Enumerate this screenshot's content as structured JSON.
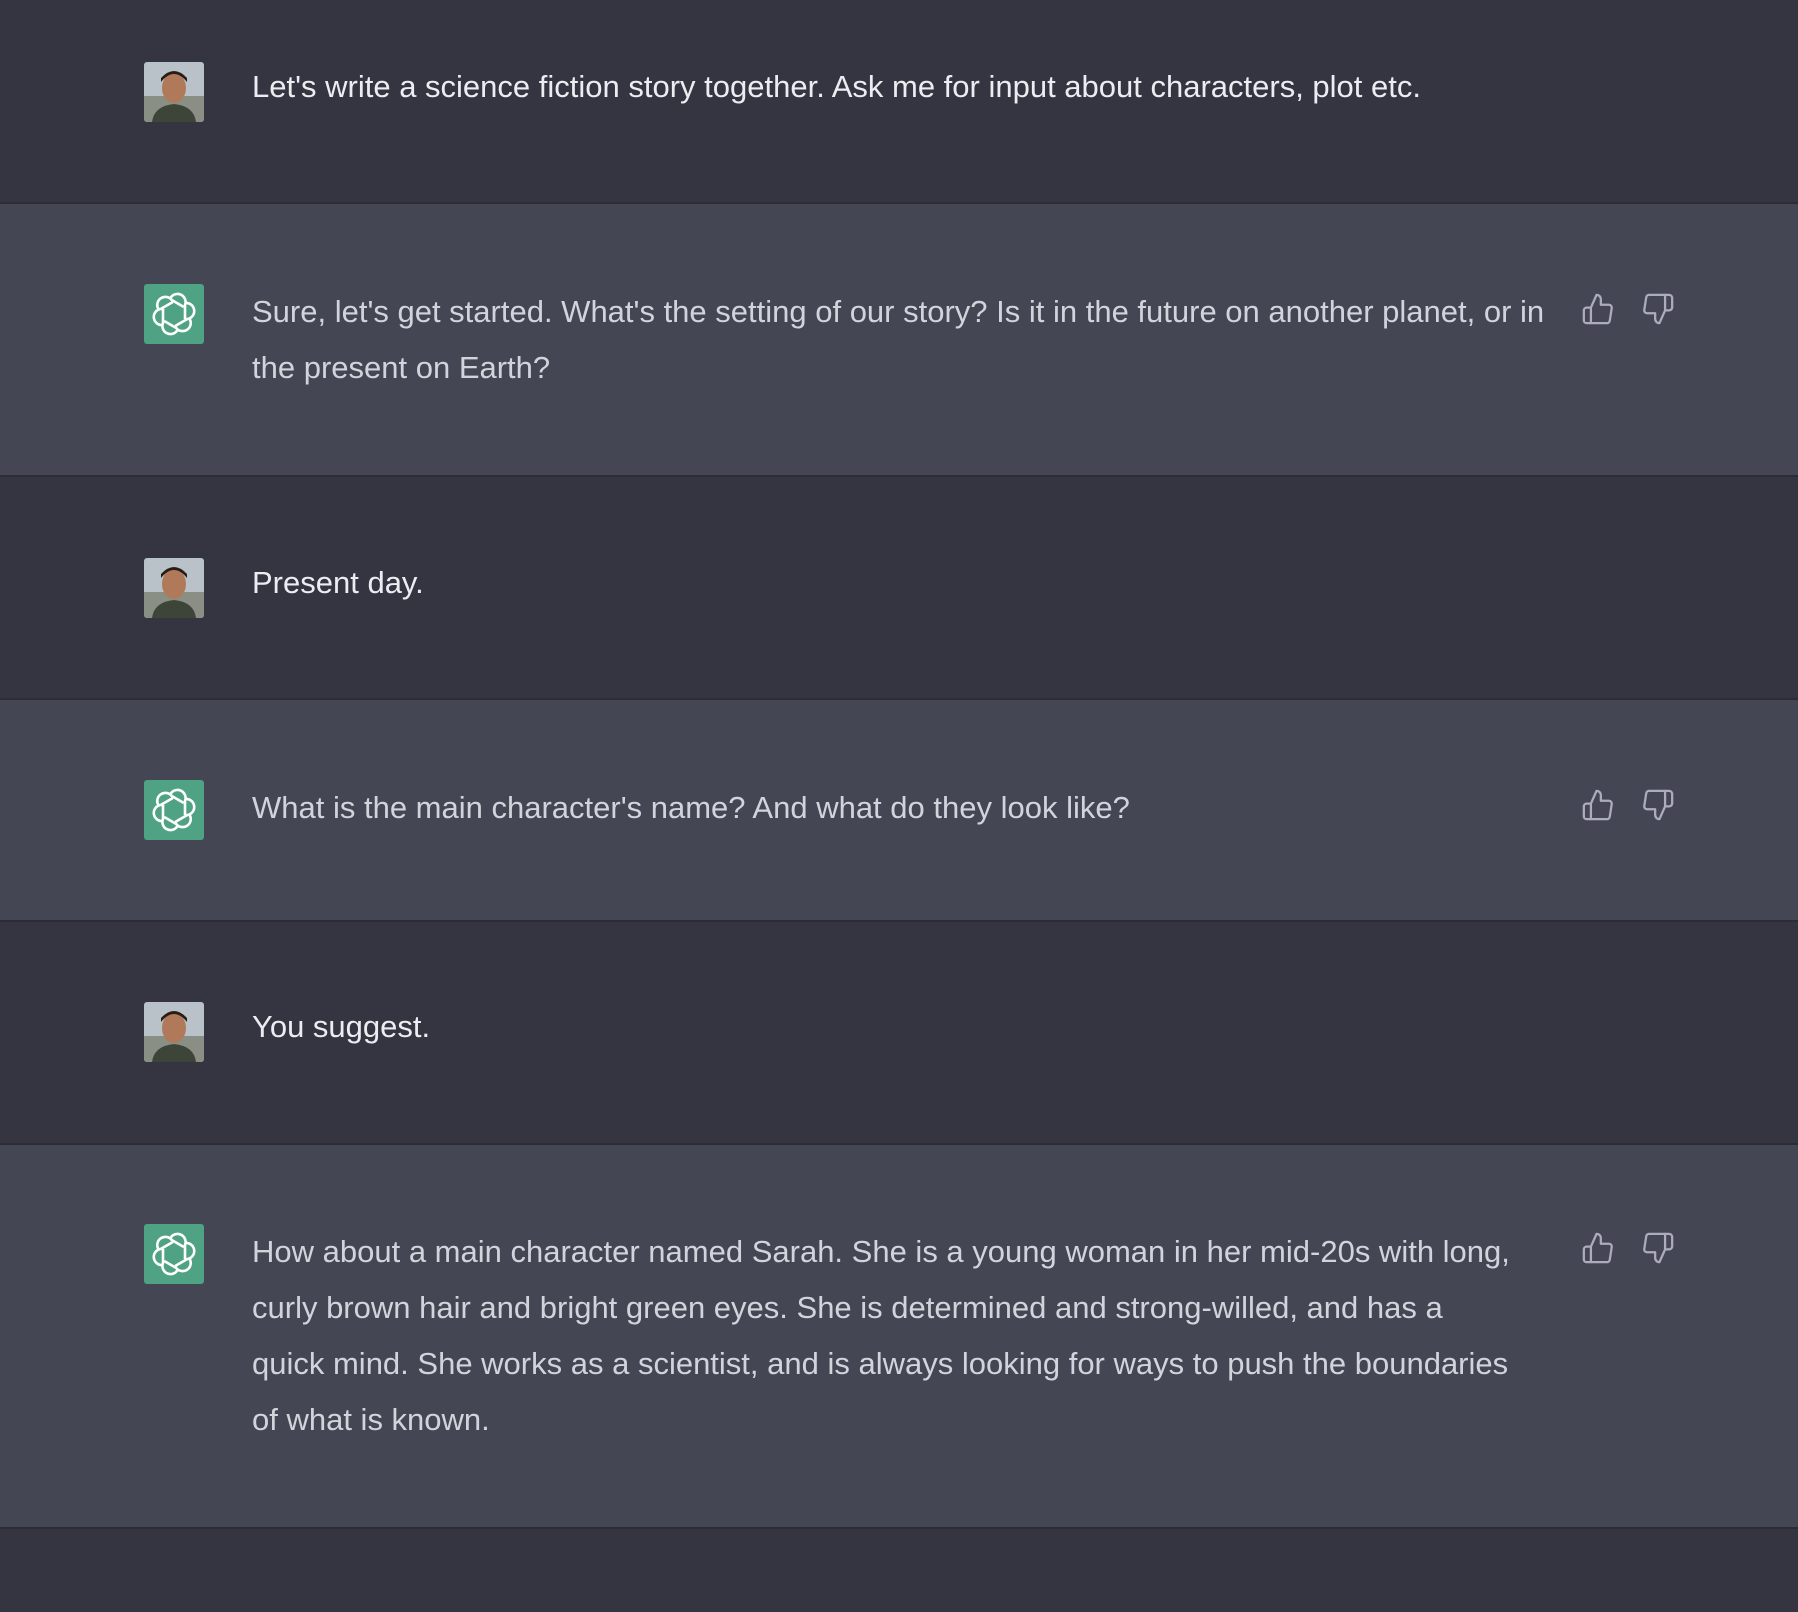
{
  "conversation": {
    "messages": [
      {
        "role": "user",
        "avatar_icon": "user-photo-avatar",
        "text": "Let's write a science fiction story together. Ask me for input about characters, plot etc."
      },
      {
        "role": "assistant",
        "avatar_icon": "openai-logo-icon",
        "text": "Sure, let's get started. What's the setting of our story? Is it in the future on another planet, or in the present on Earth?"
      },
      {
        "role": "user",
        "avatar_icon": "user-photo-avatar",
        "text": "Present day."
      },
      {
        "role": "assistant",
        "avatar_icon": "openai-logo-icon",
        "text": "What is the main character's name? And what do they look like?"
      },
      {
        "role": "user",
        "avatar_icon": "user-photo-avatar",
        "text": "You suggest."
      },
      {
        "role": "assistant",
        "avatar_icon": "openai-logo-icon",
        "text": "How about a main character named Sarah. She is a young woman in her mid-20s with long, curly brown hair and bright green eyes. She is determined and strong-willed, and has a quick mind. She works as a scientist, and is always looking for ways to push the boundaries of what is known."
      }
    ],
    "feedback_icons": [
      "thumbs-up-icon",
      "thumbs-down-icon"
    ]
  },
  "colors": {
    "user_row_bg": "#343541",
    "assistant_row_bg": "#444654",
    "assistant_avatar_bg": "#4fa384",
    "user_text": "#ececf1",
    "assistant_text": "#d1d5db",
    "icon_color": "#acacbe"
  }
}
